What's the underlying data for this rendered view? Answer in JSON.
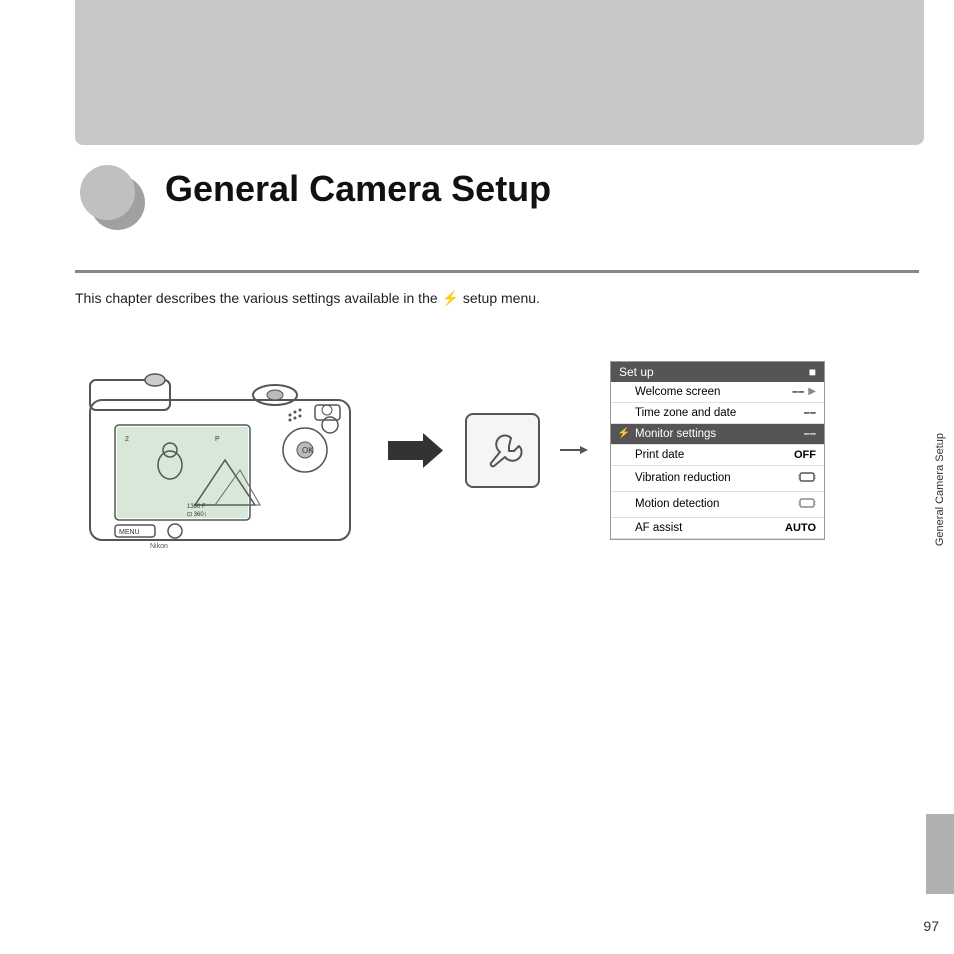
{
  "topBanner": {},
  "chapter": {
    "title": "General Camera Setup",
    "description_before": "This chapter describes the various settings available in the",
    "description_after": "setup menu.",
    "setup_symbol": "Y"
  },
  "sidebar": {
    "label": "General Camera Setup"
  },
  "pageNumber": "97",
  "menu": {
    "header": "Set up",
    "header_icon": "■",
    "items": [
      {
        "label": "Welcome screen",
        "value": "––",
        "hasArrow": true,
        "active": false,
        "icon": ""
      },
      {
        "label": "Time zone and date",
        "value": "––",
        "hasArrow": false,
        "active": false,
        "icon": ""
      },
      {
        "label": "Monitor settings",
        "value": "––",
        "hasArrow": false,
        "active": true,
        "icon": "Y"
      },
      {
        "label": "Print date",
        "value": "OFF",
        "hasArrow": false,
        "active": false,
        "icon": ""
      },
      {
        "label": "Vibration reduction",
        "value": "🤝",
        "hasArrow": false,
        "active": false,
        "icon": ""
      },
      {
        "label": "Motion detection",
        "value": "",
        "hasArrow": false,
        "active": false,
        "icon": ""
      },
      {
        "label": "AF assist",
        "value": "AUTO",
        "hasArrow": false,
        "active": false,
        "icon": ""
      }
    ]
  },
  "wrench": {
    "symbol": "🔧"
  },
  "arrow": {
    "symbol": "➤"
  }
}
